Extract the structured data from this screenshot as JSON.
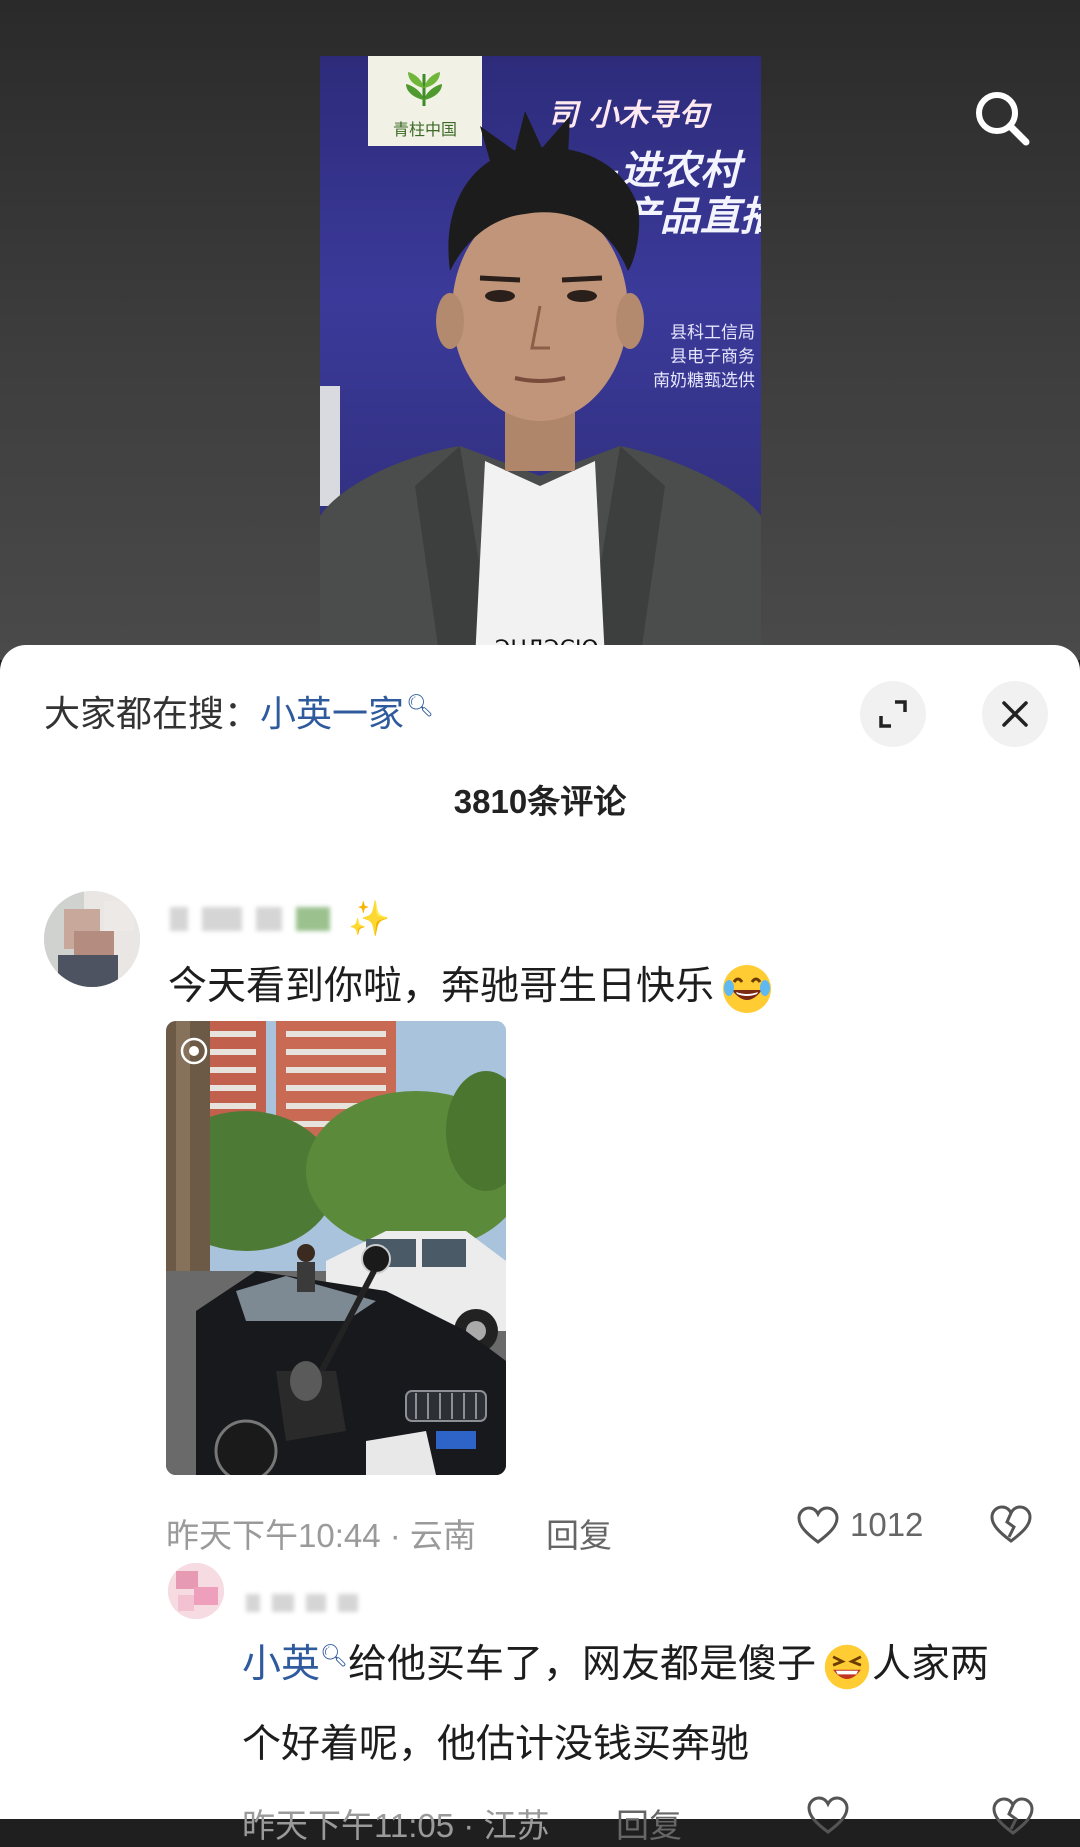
{
  "video": {
    "banner_logo_text": "青柱中国",
    "banner_line1": "司 小木寻句",
    "banner_line2": "—进农村",
    "banner_line3": "产品直播",
    "banner_small1": "县科工信局",
    "banner_small2": "县电子商务",
    "banner_small3": "南奶糖甄选供"
  },
  "sheet": {
    "search_prefix": "大家都在搜：",
    "search_keyword": "小英一家",
    "comment_count": "3810条评论"
  },
  "comments": [
    {
      "text": "今天看到你啦，奔驰哥生日快乐",
      "time_location": "昨天下午10:44 · 云南",
      "reply_label": "回复",
      "likes": "1012"
    },
    {
      "mention": "小英",
      "text_line1_rest": "给他买车了，网友都是傻子",
      "text_line1_tail": "人家两",
      "text_line2": "个好着呢，他估计没钱买奔驰",
      "time_location": "昨天下午11:05 · 江苏",
      "reply_label": "回复"
    }
  ]
}
